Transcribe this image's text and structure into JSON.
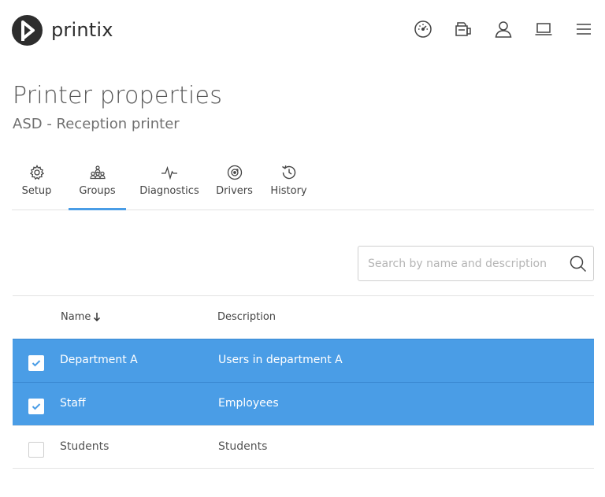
{
  "app": {
    "brand": "printix"
  },
  "topnav": {
    "icons": [
      {
        "name": "dashboard-icon"
      },
      {
        "name": "printers-icon"
      },
      {
        "name": "user-icon"
      },
      {
        "name": "computer-icon"
      },
      {
        "name": "menu-icon"
      }
    ]
  },
  "page": {
    "title": "Printer properties",
    "subtitle": "ASD - Reception printer"
  },
  "tabs": [
    {
      "label": "Setup",
      "icon": "gear-icon",
      "active": false
    },
    {
      "label": "Groups",
      "icon": "groups-icon",
      "active": true
    },
    {
      "label": "Diagnostics",
      "icon": "pulse-icon",
      "active": false
    },
    {
      "label": "Drivers",
      "icon": "disc-icon",
      "active": false
    },
    {
      "label": "History",
      "icon": "history-icon",
      "active": false
    }
  ],
  "search": {
    "placeholder": "Search by name and description",
    "value": ""
  },
  "table": {
    "columns": {
      "name": "Name",
      "description": "Description"
    },
    "sort": {
      "column": "name",
      "direction": "descending"
    },
    "rows": [
      {
        "name": "Department A",
        "description": "Users in department A",
        "checked": true
      },
      {
        "name": "Staff",
        "description": "Employees",
        "checked": true
      },
      {
        "name": "Students",
        "description": "Students",
        "checked": false
      }
    ]
  },
  "colors": {
    "accent": "#4a9de6",
    "logo": "#2d2d2d"
  }
}
